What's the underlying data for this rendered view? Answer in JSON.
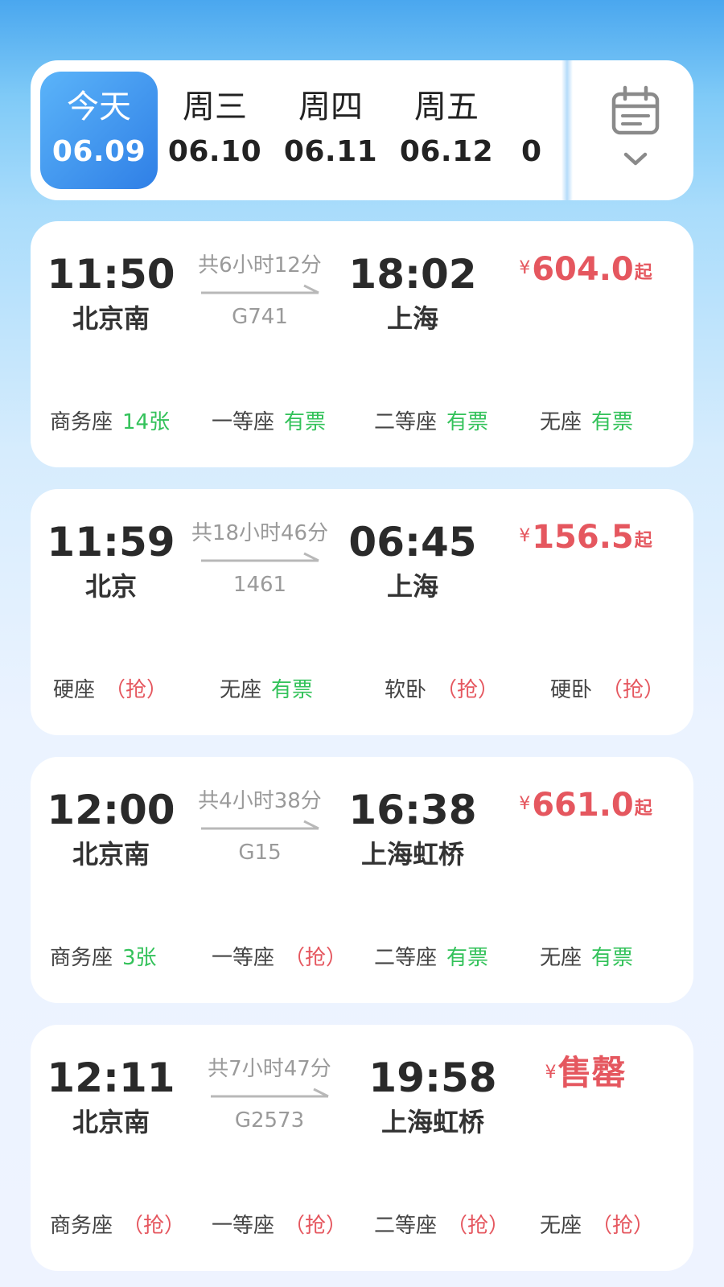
{
  "date_bar": {
    "dates": [
      {
        "dow": "今天",
        "md": "06.09",
        "active": true
      },
      {
        "dow": "周三",
        "md": "06.10",
        "active": false
      },
      {
        "dow": "周四",
        "md": "06.11",
        "active": false
      },
      {
        "dow": "周五",
        "md": "06.12",
        "active": false
      },
      {
        "dow": "",
        "md": "0",
        "active": false
      }
    ],
    "calendar_icon": "calendar-icon",
    "expand_icon": "chevron-down-icon"
  },
  "colors": {
    "accent": "#2f7fe6",
    "price": "#e5575f",
    "available": "#33c25a",
    "grab": "#e5575f"
  },
  "trains": [
    {
      "dep_time": "11:50",
      "dep_station": "北京南",
      "duration": "共6小时12分",
      "train_no": "G741",
      "arr_time": "18:02",
      "arr_station": "上海",
      "price_currency": "¥",
      "price_value": "604.0",
      "price_suffix": "起",
      "seats": [
        {
          "type": "商务座",
          "status": "14张",
          "color": "green"
        },
        {
          "type": "一等座",
          "status": "有票",
          "color": "green"
        },
        {
          "type": "二等座",
          "status": "有票",
          "color": "green"
        },
        {
          "type": "无座",
          "status": "有票",
          "color": "green"
        }
      ]
    },
    {
      "dep_time": "11:59",
      "dep_station": "北京",
      "duration": "共18小时46分",
      "train_no": "1461",
      "arr_time": "06:45",
      "arr_station": "上海",
      "price_currency": "¥",
      "price_value": "156.5",
      "price_suffix": "起",
      "seats": [
        {
          "type": "硬座",
          "status": "（抢）",
          "color": "red"
        },
        {
          "type": "无座",
          "status": "有票",
          "color": "green"
        },
        {
          "type": "软卧",
          "status": "（抢）",
          "color": "red"
        },
        {
          "type": "硬卧",
          "status": "（抢）",
          "color": "red"
        }
      ]
    },
    {
      "dep_time": "12:00",
      "dep_station": "北京南",
      "duration": "共4小时38分",
      "train_no": "G15",
      "arr_time": "16:38",
      "arr_station": "上海虹桥",
      "price_currency": "¥",
      "price_value": "661.0",
      "price_suffix": "起",
      "seats": [
        {
          "type": "商务座",
          "status": "3张",
          "color": "green"
        },
        {
          "type": "一等座",
          "status": "（抢）",
          "color": "red"
        },
        {
          "type": "二等座",
          "status": "有票",
          "color": "green"
        },
        {
          "type": "无座",
          "status": "有票",
          "color": "green"
        }
      ]
    },
    {
      "dep_time": "12:11",
      "dep_station": "北京南",
      "duration": "共7小时47分",
      "train_no": "G2573",
      "arr_time": "19:58",
      "arr_station": "上海虹桥",
      "price_currency": "¥",
      "price_value": "售罄",
      "price_suffix": "",
      "seats": [
        {
          "type": "商务座",
          "status": "（抢）",
          "color": "red"
        },
        {
          "type": "一等座",
          "status": "（抢）",
          "color": "red"
        },
        {
          "type": "二等座",
          "status": "（抢）",
          "color": "red"
        },
        {
          "type": "无座",
          "status": "（抢）",
          "color": "red"
        }
      ]
    }
  ]
}
